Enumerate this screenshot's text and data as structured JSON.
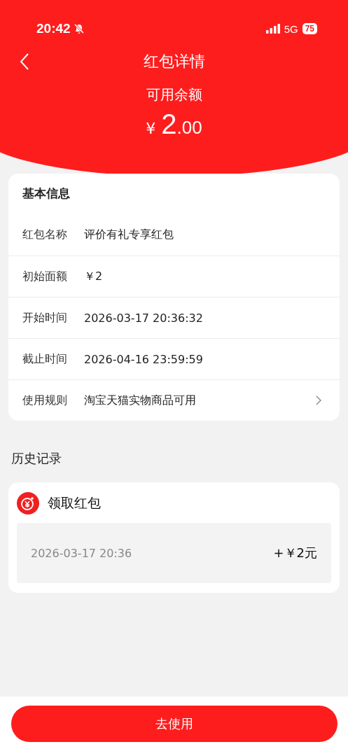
{
  "status_bar": {
    "time": "20:42",
    "network": "5G",
    "battery": "75"
  },
  "nav": {
    "title": "红包详情"
  },
  "balance": {
    "label": "可用余额",
    "currency": "¥",
    "integer": "2",
    "fraction": ".00"
  },
  "basic_info": {
    "title": "基本信息",
    "rows": [
      {
        "kind": "plain",
        "label": "红包名称",
        "value": "评价有礼专享红包"
      },
      {
        "kind": "plain",
        "label": "初始面额",
        "value": "￥2"
      },
      {
        "kind": "plain",
        "label": "开始时间",
        "value": "2026-03-17 20:36:32"
      },
      {
        "kind": "plain",
        "label": "截止时间",
        "value": "2026-04-16 23:59:59"
      },
      {
        "kind": "link",
        "label": "使用规则",
        "value": "淘宝天猫实物商品可用"
      }
    ]
  },
  "history": {
    "title": "历史记录",
    "records": [
      {
        "title": "领取红包",
        "time": "2026-03-17 20:36",
        "amount": "+￥2元"
      }
    ]
  },
  "use_button": "去使用"
}
